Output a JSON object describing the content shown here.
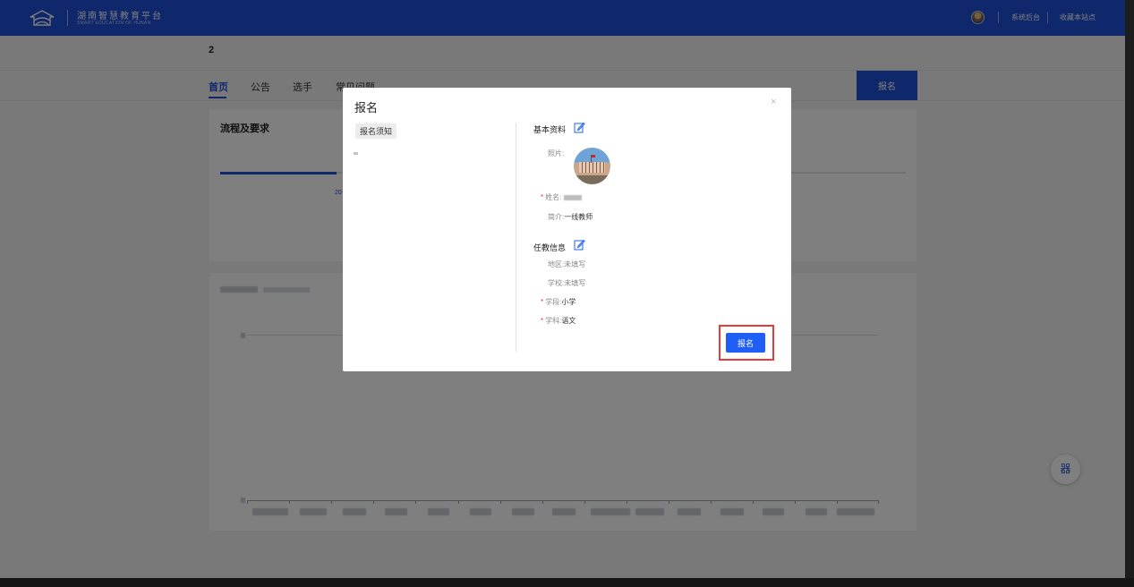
{
  "header": {
    "title": "湖南智慧教育平台",
    "subtitle": "SMART EDUCATION OF HUNAN",
    "links": [
      "系统后台",
      "收藏本站点"
    ]
  },
  "page": {
    "number": "2",
    "tabs": [
      "首页",
      "公告",
      "选手",
      "常见问题"
    ],
    "active_tab": "首页",
    "signup_label": "报名",
    "card_title": "流程及要求",
    "date_fragment": "20",
    "progress": 0.17
  },
  "modal": {
    "title": "报名",
    "close_label": "×",
    "notice_tag": "报名须知",
    "basic_section": "基本资料",
    "photo_label": "照片:",
    "name_label": "姓名:",
    "intro_label": "简介:",
    "intro_value": "一线教师",
    "teaching_section": "任教信息",
    "region_label": "地区:",
    "region_value": "未填写",
    "school_label": "学校:",
    "school_value": "未填写",
    "stage_label": "学段:",
    "stage_value": "小学",
    "subject_label": "学科:",
    "subject_value": "语文",
    "required_mark": "*",
    "submit_label": "报名"
  },
  "floating": {
    "qr_label": "器"
  },
  "colors": {
    "brand": "#1f4fd6",
    "required": "#e53b3b",
    "highlight": "#e53b3b"
  }
}
